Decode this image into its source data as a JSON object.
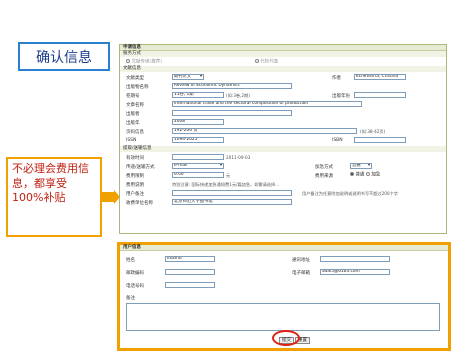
{
  "slide": {
    "title": "确认信息",
    "note": "不必理会费用信息，都享受100%补贴"
  },
  "form": {
    "header": "申请信息",
    "service_section": "服务方式",
    "service_options": [
      "文献传递(推荐)",
      "代检代查"
    ],
    "doc_section": "文献信息",
    "doc_type_label": "文献类型",
    "doc_type_value": "期刊论文",
    "author_label": "作者",
    "author_value": "Echevarria, Cristina",
    "journal_label": "出版物名称",
    "journal_value": "Review of Economic Dynamics",
    "year_label": "卷期号",
    "year_value": "11卷, 1期",
    "year_hint": "(如:3卷,2期)",
    "pubyear_label": "出版年份",
    "title_label": "文章名称",
    "title_value": "International trade and the sectoral composition of production",
    "publisher_label": "出版者",
    "pub_label": "出版年",
    "pub_value": "2008",
    "pages_label": "页码信息",
    "pages_value": "192-206 页",
    "pages_hint": "(如:38-42页)",
    "issn_label": "ISSN",
    "issn_value": "1094-2025",
    "isbn_label": "ISBN",
    "delivery_section": "提取/送输信息",
    "deadline_label": "有效时间",
    "deadline_value": "2011-09-03",
    "method_label": "传递/送输方式",
    "method_value": "e-mail",
    "urgent_label": "加急方式",
    "urgent_value": "普通",
    "max_fee_label": "费用限制",
    "max_fee_value": "6.00",
    "max_fee_unit": "元",
    "fee_source_label": "费用来源",
    "fee_source_options": [
      "普通",
      "加急"
    ],
    "cost_label": "费用说明",
    "cost_note": "特别注意: 国际快递加急通知费1元/篇加急，如需请选择...",
    "note_label": "用户备注",
    "note_hint": "用户备注为任意附加说明或说明书写不超过200个字",
    "org_label": "收费单位名称",
    "org_value": "北京师范大学图书馆"
  },
  "user": {
    "header": "用户信息",
    "name_label": "姓名",
    "name_value": "Ilxamu",
    "address_label": "通讯地址",
    "zip_label": "邮政编码",
    "email_label": "电子邮箱",
    "email_value": "adai5@6163.com",
    "phone_label": "电话号码",
    "remark_label": "备注",
    "submit_label": "提交",
    "reset_label": "重置"
  },
  "colors": {
    "accent": "#f0a000",
    "title_border": "#2a7fd0",
    "note_text": "#c02010",
    "highlight": "#e02010"
  }
}
